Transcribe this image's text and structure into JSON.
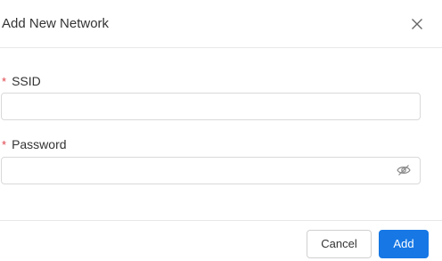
{
  "dialog": {
    "title": "Add New Network"
  },
  "form": {
    "ssid": {
      "label": "SSID",
      "required_mark": "*",
      "value": ""
    },
    "password": {
      "label": "Password",
      "required_mark": "*",
      "value": ""
    }
  },
  "icons": {
    "close": "close-icon",
    "password_visibility": "eye-off-icon"
  },
  "buttons": {
    "cancel_label": "Cancel",
    "add_label": "Add"
  },
  "colors": {
    "primary": "#1677e5",
    "required": "#e0434b",
    "border": "#d9d9d9"
  }
}
